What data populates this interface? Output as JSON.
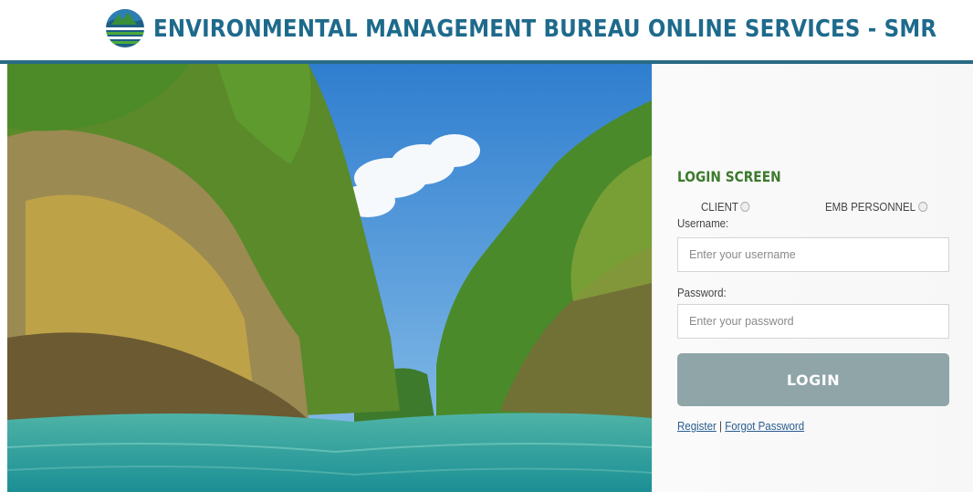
{
  "header": {
    "title": "ENVIRONMENTAL MANAGEMENT BUREAU ONLINE SERVICES - SMR",
    "title_color": "#1e6a8c",
    "rule_color": "#2a6b85",
    "logo_icon": "emb-globe-logo-icon"
  },
  "login": {
    "heading": "LOGIN SCREEN",
    "heading_color": "#3d7a2e",
    "radio_client": "CLIENT",
    "radio_emb": "EMB PERSONNEL",
    "username_label": "Username:",
    "username_placeholder": "Enter your username",
    "password_label": "Password:",
    "password_placeholder": "Enter your password",
    "login_button": "LOGIN",
    "button_color": "#8fa5a8",
    "register_link": "Register",
    "separator": " | ",
    "forgot_link": "Forgot Password"
  }
}
